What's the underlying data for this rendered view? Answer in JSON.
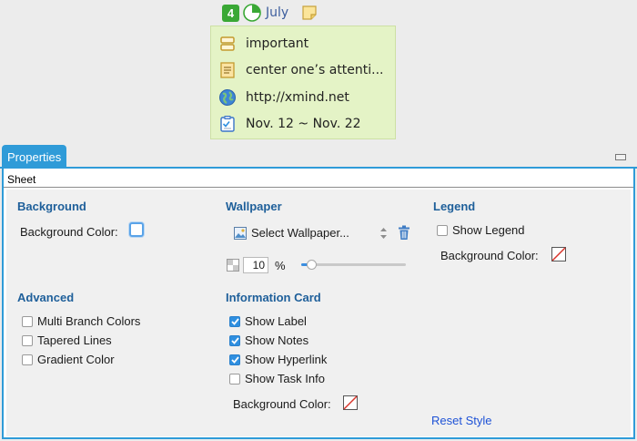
{
  "topic": {
    "priority": "4",
    "progress_fraction": 0.25,
    "month": "July",
    "icons": {
      "priority": "priority-4-icon",
      "progress": "progress-pie-icon",
      "note": "sticky-note-icon"
    },
    "card": {
      "label": "important",
      "note": "center one’s attenti...",
      "hyperlink": "http://xmind.net",
      "task": "Nov. 12 ~ Nov. 22"
    }
  },
  "panel": {
    "tab_label": "Properties",
    "sheet_label": "Sheet",
    "background": {
      "title": "Background",
      "color_label": "Background Color:"
    },
    "wallpaper": {
      "title": "Wallpaper",
      "select_label": "Select Wallpaper...",
      "opacity_value": "10",
      "opacity_unit": "%",
      "slider_fraction": 0.1
    },
    "legend": {
      "title": "Legend",
      "show_label": "Show Legend",
      "show_checked": false,
      "color_label": "Background Color:"
    },
    "advanced": {
      "title": "Advanced",
      "options": [
        {
          "label": "Multi Branch Colors",
          "checked": false
        },
        {
          "label": "Tapered Lines",
          "checked": false
        },
        {
          "label": "Gradient Color",
          "checked": false
        }
      ]
    },
    "info_card": {
      "title": "Information Card",
      "options": [
        {
          "label": "Show Label",
          "checked": true
        },
        {
          "label": "Show Notes",
          "checked": true
        },
        {
          "label": "Show Hyperlink",
          "checked": true
        },
        {
          "label": "Show Task Info",
          "checked": false
        }
      ],
      "color_label": "Background Color:"
    },
    "reset_label": "Reset Style"
  },
  "colors": {
    "accent": "#2f9bd8",
    "section_title": "#1e5f9a",
    "card_background": "#e4f3c6",
    "priority_badge": "#3aa835",
    "link": "#1f53d6"
  }
}
